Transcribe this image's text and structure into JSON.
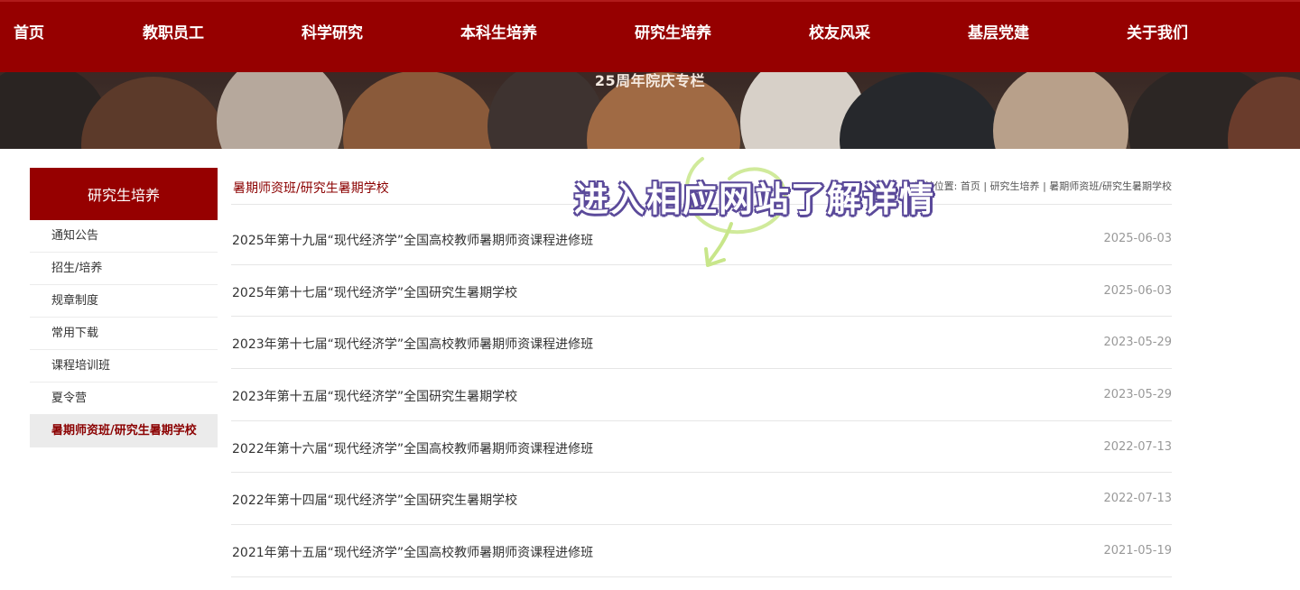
{
  "nav": {
    "items": [
      {
        "label": "首页",
        "icon": ""
      },
      {
        "label": "教职员工"
      },
      {
        "label": "科学研究"
      },
      {
        "label": "本科生培养"
      },
      {
        "label": "研究生培养"
      },
      {
        "label": "校友风采"
      },
      {
        "label": "基层党建"
      },
      {
        "label": "关于我们"
      }
    ]
  },
  "banner": {
    "subtitle": "25周年院庆专栏"
  },
  "sidebar": {
    "title": "研究生培养",
    "items": [
      {
        "label": "通知公告"
      },
      {
        "label": "招生/培养"
      },
      {
        "label": "规章制度"
      },
      {
        "label": "常用下载"
      },
      {
        "label": "课程培训班"
      },
      {
        "label": "夏令营"
      },
      {
        "label": "暑期师资班/研究生暑期学校"
      }
    ],
    "active_index": 6
  },
  "content": {
    "title": "暑期师资班/研究生暑期学校",
    "breadcrumb": {
      "prefix": "当前位置:",
      "home": "首页",
      "sep": "|",
      "level1": "研究生培养",
      "level2": "暑期师资班/研究生暑期学校"
    },
    "news": [
      {
        "title": "2025年第十九届“现代经济学”全国高校教师暑期师资课程进修班",
        "date": "2025-06-03"
      },
      {
        "title": "2025年第十七届“现代经济学”全国研究生暑期学校",
        "date": "2025-06-03"
      },
      {
        "title": "2023年第十七届“现代经济学”全国高校教师暑期师资课程进修班",
        "date": "2023-05-29"
      },
      {
        "title": "2023年第十五届“现代经济学”全国研究生暑期学校",
        "date": "2023-05-29"
      },
      {
        "title": "2022年第十六届“现代经济学”全国高校教师暑期师资课程进修班",
        "date": "2022-07-13"
      },
      {
        "title": "2022年第十四届“现代经济学”全国研究生暑期学校",
        "date": "2022-07-13"
      },
      {
        "title": "2021年第十五届“现代经济学”全国高校教师暑期师资课程进修班",
        "date": "2021-05-19"
      }
    ]
  },
  "overlay": {
    "text": "进入相应网站了解详情",
    "arrow_icon": "curved-arrow-down-icon",
    "text_color": "#ffffff",
    "outline_color": "#5b4a9a",
    "arrow_color": "#c8e68a"
  },
  "colors": {
    "brand": "#960000",
    "accent_text": "#8b0000",
    "date_text": "#999999",
    "body_text": "#333333"
  }
}
